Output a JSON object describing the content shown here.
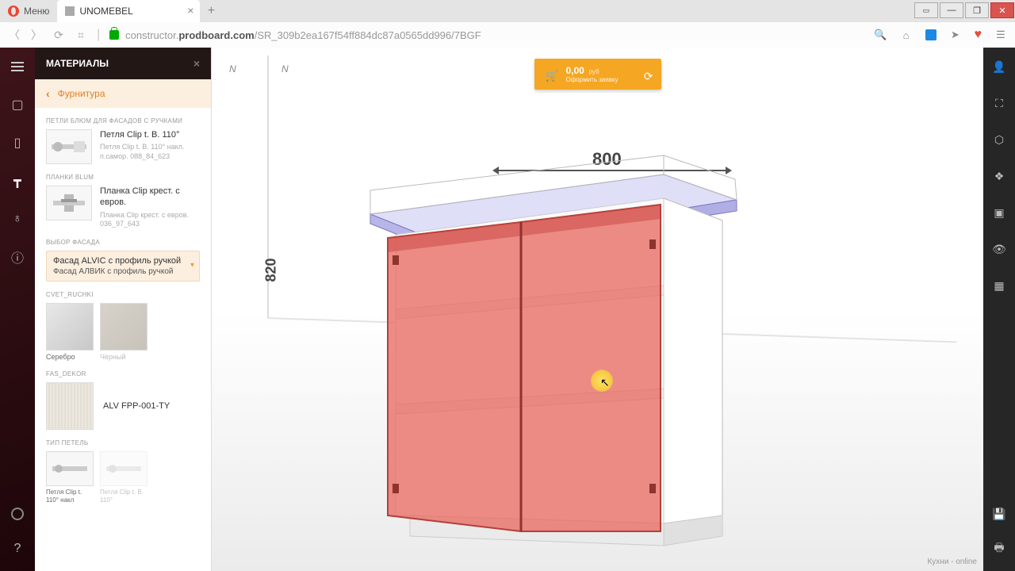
{
  "browser": {
    "menu": "Меню",
    "tabTitle": "UNOMEBEL",
    "urlPrefix": "constructor.",
    "urlHost": "prodboard.com",
    "urlPath": "/SR_309b2ea167f54ff884dc87a0565dd996/7BGF"
  },
  "panel": {
    "title": "МАТЕРИАЛЫ",
    "breadcrumb": "Фурнитура"
  },
  "sections": {
    "hingesLabel": "ПЕТЛИ БЛЮМ ДЛЯ ФАСАДОВ С РУЧКАМИ",
    "hinge": {
      "title": "Петля Clip t. B. 110°",
      "sub": "Петля Clip t. B. 110° накл. п.самор. 088_84_623"
    },
    "plankiLabel": "ПЛАНКИ BLUM",
    "planka": {
      "title": "Планка Clip крест. с евров.",
      "sub": "Планка Clip крест. с евров. 036_97_643"
    },
    "facadeLabel": "ВЫБОР ФАСАДА",
    "facadeLine1": "Фасад ALVIC с профиль ручкой",
    "facadeLine2": "Фасад АЛВИК с профиль ручкой",
    "cvetLabel": "CVET_RUCHKI",
    "swatch1": "Серебро",
    "swatch2": "Черный",
    "dekorLabel": "FAS_DEKOR",
    "dekorName": "ALV FPP-001-TY",
    "hingeTypeLabel": "ТИП ПЕТЕЛЬ",
    "hingeOpt1": "Петля Clip t. 110° накл",
    "hingeOpt2": "Петля Clip t. B. 110°"
  },
  "viewport": {
    "price": "0,00",
    "currency": "руб",
    "orderLabel": "Оформить заявку",
    "dimW": "800",
    "dimH": "820",
    "axis1": "N",
    "axis2": "N"
  },
  "footer": {
    "status": "Кухни - online"
  }
}
